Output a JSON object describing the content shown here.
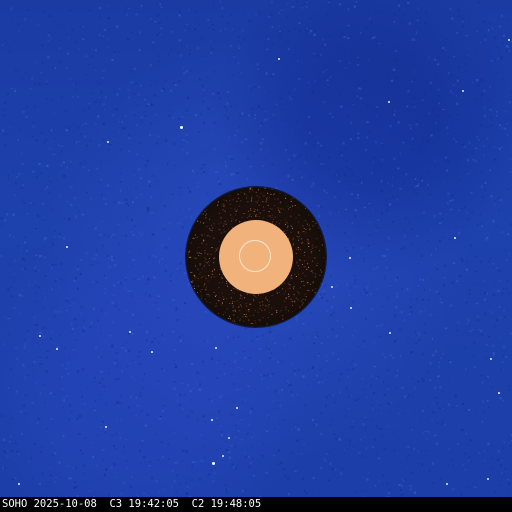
{
  "image": {
    "caption": "SOHO 2025-10-08  C3 19:42:05  C2 19:48:05",
    "colors": {
      "sky": "#1e3fa8",
      "occulter": "#1a0f0a",
      "sun_disk": "#f1b27c",
      "limb_outline": "#f7e7d2",
      "caption_bar": "#000000",
      "caption_text": "#ffffff"
    }
  }
}
